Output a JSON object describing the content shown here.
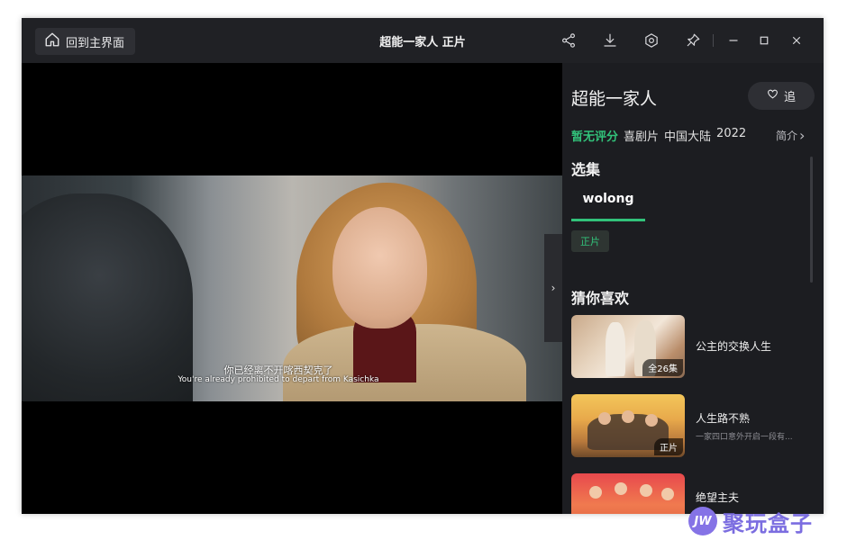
{
  "titlebar": {
    "home_label": "回到主界面",
    "title": "超能一家人 正片"
  },
  "video": {
    "subtitle_cn": "你已经离不开喀西契克了",
    "subtitle_en": "You're already prohibited to depart from Kasichka"
  },
  "sidebar": {
    "show_title": "超能一家人",
    "follow_label": "追",
    "meta": {
      "rating": "暂无评分",
      "genre": "喜剧片",
      "region": "中国大陆",
      "year": "2022"
    },
    "intro_label": "简介",
    "episodes_heading": "选集",
    "source_tab": "wolong",
    "episode_chip": "正片",
    "recommend_heading": "猜你喜欢",
    "recommendations": [
      {
        "title": "公主的交换人生",
        "badge": "全26集",
        "desc": ""
      },
      {
        "title": "人生路不熟",
        "badge": "正片",
        "desc": "一家四口意外开启一段有..."
      },
      {
        "title": "绝望主夫",
        "badge": "",
        "desc": ""
      }
    ]
  },
  "watermark": {
    "logo": "JW",
    "text": "聚玩盒子"
  },
  "colors": {
    "accent": "#32c27a",
    "background": "#1c1d21",
    "titlebar": "#202125",
    "watermark": "#7b6de0"
  }
}
